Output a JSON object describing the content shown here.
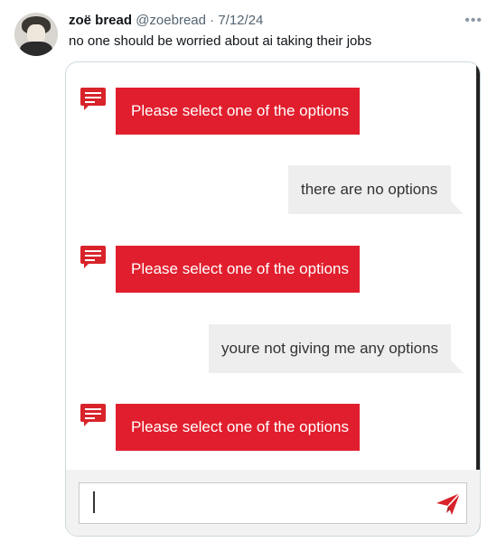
{
  "tweet": {
    "author_name": "zoë bread",
    "handle": "@zoebread",
    "separator": "·",
    "date": "7/12/24",
    "text": "no one should be worried about ai taking their jobs",
    "more_icon": "more-horizontal-icon"
  },
  "chat": {
    "brand_color": "#e11e2d",
    "messages": [
      {
        "sender": "bot",
        "text": "Please select one of the options"
      },
      {
        "sender": "user",
        "text": "there are no options"
      },
      {
        "sender": "bot",
        "text": "Please select one of the options"
      },
      {
        "sender": "user",
        "text": "youre not giving me any options"
      },
      {
        "sender": "bot",
        "text": "Please select one of the options"
      }
    ],
    "input": {
      "value": ""
    },
    "icons": {
      "bot": "chat-bubble-icon",
      "send": "paper-plane-icon"
    }
  }
}
